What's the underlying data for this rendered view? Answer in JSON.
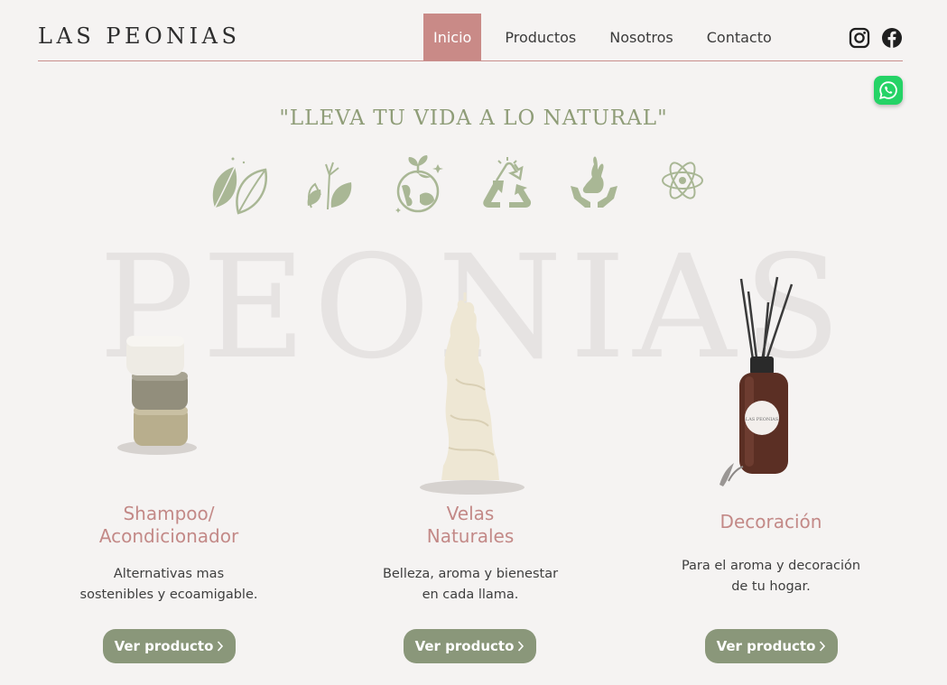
{
  "brand": {
    "name": "LAS PEONIAS"
  },
  "nav": {
    "items": [
      {
        "label": "Inicio",
        "active": true
      },
      {
        "label": "Productos",
        "active": false
      },
      {
        "label": "Nosotros",
        "active": false
      },
      {
        "label": "Contacto",
        "active": false
      }
    ]
  },
  "social": {
    "icons": [
      "instagram-icon",
      "facebook-icon",
      "whatsapp-icon"
    ]
  },
  "hero": {
    "tagline": "\"LLEVA TU VIDA A LO NATURAL\"",
    "watermark": "PEONIAS",
    "icons": [
      "leaves-icon",
      "hands-leaves-icon",
      "earth-plant-icon",
      "recycle-icon",
      "rabbit-hands-icon",
      "atom-icon"
    ]
  },
  "products": [
    {
      "title_line1": "Shampoo/",
      "title_line2": "Acondicionador",
      "desc_line1": "Alternativas mas",
      "desc_line2": "sostenibles y ecoamigable.",
      "button": "Ver producto"
    },
    {
      "title_line1": "Velas",
      "title_line2": "Naturales",
      "desc_line1": "Belleza, aroma y bienestar",
      "desc_line2": "en cada llama.",
      "button": "Ver producto"
    },
    {
      "title_line1": "Decoración",
      "title_line2": "",
      "desc_line1": "Para el aroma y decoración",
      "desc_line2": "de tu hogar.",
      "button": "Ver producto"
    }
  ],
  "diffuser_label": "LAS PEONIAS",
  "colors": {
    "accent_rose": "#c98a87",
    "sage_green": "#8a977a",
    "icon_green": "#a9b795",
    "whatsapp": "#25d366"
  }
}
